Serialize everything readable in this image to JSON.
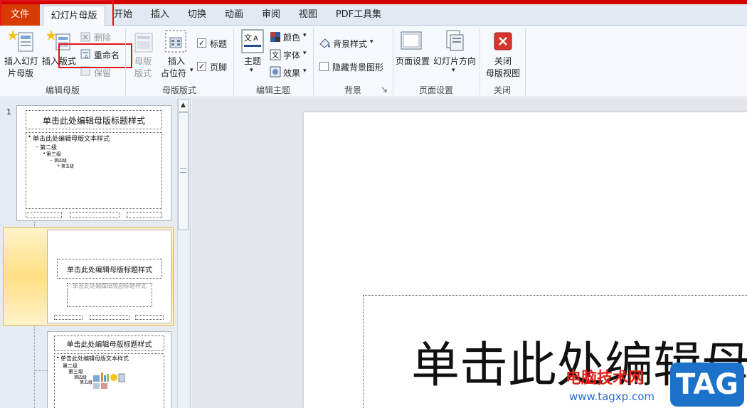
{
  "tabs": {
    "file": "文件",
    "slide_master": "幻灯片母版",
    "home": "开始",
    "insert": "插入",
    "transitions": "切换",
    "animations": "动画",
    "review": "审阅",
    "view": "视图",
    "pdf_tools": "PDF工具集"
  },
  "ribbon": {
    "edit_master": {
      "group_label": "编辑母版",
      "insert_slide_master": [
        "插入幻灯",
        "片母版"
      ],
      "insert_layout": "插入版式",
      "delete": "删除",
      "rename": "重命名",
      "preserve": "保留"
    },
    "master_layout": {
      "group_label": "母版版式",
      "master_layout_btn": [
        "母版",
        "版式"
      ],
      "insert_placeholder": [
        "插入",
        "占位符"
      ],
      "title_checkbox": "标题",
      "footer_checkbox": "页脚"
    },
    "edit_theme": {
      "group_label": "编辑主题",
      "themes": "主题",
      "colors": "颜色",
      "fonts": "字体",
      "effects": "效果"
    },
    "background": {
      "group_label": "背景",
      "background_styles": "背景样式",
      "hide_background": "隐藏背景图形"
    },
    "page_setup": {
      "group_label": "页面设置",
      "page_setup_btn": "页面设置",
      "orientation": "幻灯片方向"
    },
    "close": {
      "group_label": "关闭",
      "close_master": [
        "关闭",
        "母版视图"
      ]
    }
  },
  "thumbnails": {
    "slide_number": "1",
    "master_title": "单击此处编辑母版标题样式",
    "master_text": "单击此处编辑母版文本样式",
    "levels": [
      "第二级",
      "第三级",
      "第四级",
      "第五级"
    ],
    "layout_subtitle": "单击此处编辑母版副标题样式"
  },
  "slide": {
    "title_partial": "单击此处编辑母"
  },
  "watermark": {
    "site_name": "电脑技术网",
    "url": "www.tagxp.com",
    "tag": "TAG"
  },
  "colors": {
    "file_tab": "#d83b01",
    "highlight_box": "#e3141b",
    "watermark_blue": "#1c72c9"
  }
}
